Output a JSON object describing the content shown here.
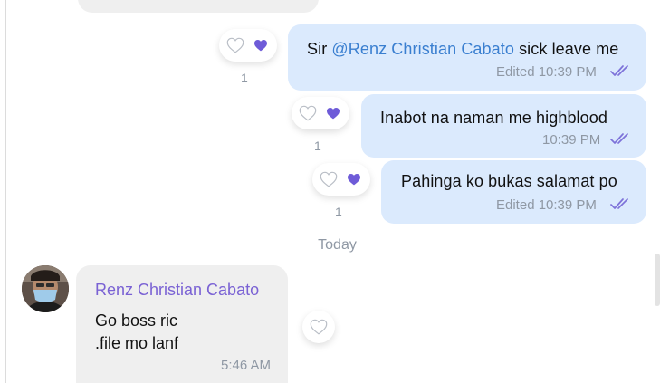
{
  "messages_out": [
    {
      "prefix": "Sir ",
      "mention": "@Renz Christian Cabato",
      "suffix": " sick leave me",
      "meta": "Edited 10:39 PM",
      "reaction_count": "1"
    },
    {
      "text": "Inabot na naman me highblood",
      "meta": "10:39 PM",
      "reaction_count": "1"
    },
    {
      "text": "Pahinga ko bukas salamat po",
      "meta": "Edited 10:39 PM",
      "reaction_count": "1"
    }
  ],
  "date_separator": "Today",
  "incoming": {
    "sender": "Renz Christian Cabato",
    "lines": [
      "Go boss ric",
      ".file mo lanf"
    ],
    "time": "5:46 AM"
  },
  "icons": {
    "reaction_outline": "heart-outline-icon",
    "reaction_filled": "heart-filled-icon",
    "read_receipt": "double-check-icon"
  },
  "colors": {
    "outgoing_bubble": "#dbeafd",
    "incoming_bubble": "#efefef",
    "mention": "#3a7fd0",
    "sender_name": "#7a62d4",
    "heart_filled": "#6e5bd8",
    "check": "#7d72d9"
  }
}
